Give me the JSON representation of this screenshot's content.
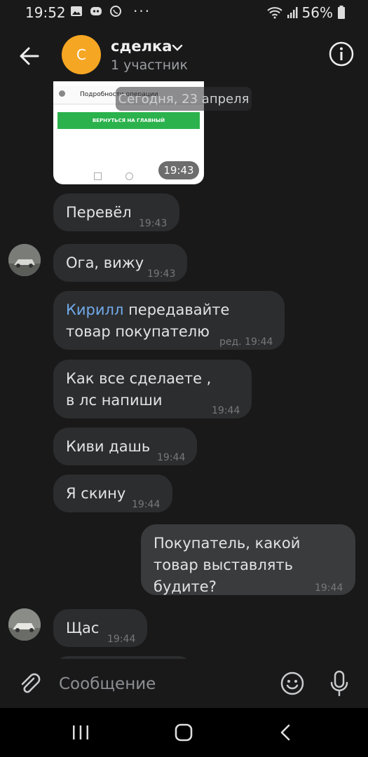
{
  "status": {
    "time": "19:52",
    "battery": "56%",
    "more": "···"
  },
  "header": {
    "title": "сделка",
    "subtitle": "1 участник",
    "avatar_letter": "С"
  },
  "image_message": {
    "bar_title": "Подробности операции",
    "button_text": "ВЕРНУТЬСЯ НА ГЛАВНЫЙ",
    "time": "19:43"
  },
  "date_divider": "Сегодня, 23 апреля",
  "messages": [
    {
      "text": "Перевёл",
      "time": "19:43"
    },
    {
      "text": "Ога, вижу",
      "time": "19:43"
    },
    {
      "mention": "Кирилл",
      "text": " передавайте товар покупателю",
      "time": "ред. 19:44"
    },
    {
      "text": "Как все сделаете , в лс напиши",
      "time": "19:44"
    },
    {
      "text": "Киви дашь",
      "time": "19:44"
    },
    {
      "text": "Я скину",
      "time": "19:44"
    },
    {
      "text": "Покупатель, какой товар выставлять будите?",
      "time": "19:44"
    },
    {
      "text": "Щас",
      "time": "19:44"
    }
  ],
  "composer": {
    "placeholder": "Сообщение"
  },
  "colors": {
    "accent": "#71aaeb",
    "avatar": "#f5a623",
    "background": "#19191a",
    "bubble_in": "#2c2d2e",
    "bubble_out": "#3a3b3c"
  }
}
